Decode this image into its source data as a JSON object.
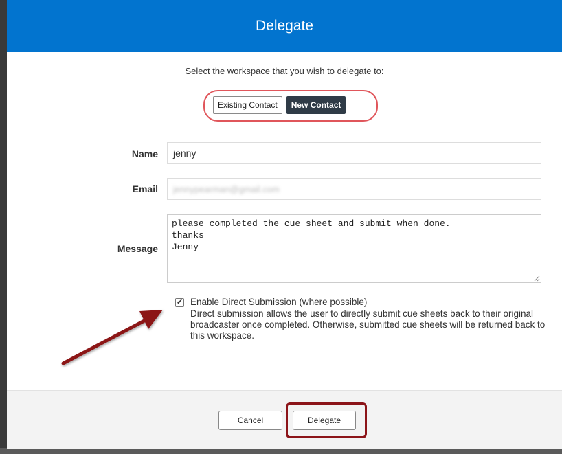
{
  "dialog": {
    "title": "Delegate",
    "prompt": "Select the workspace that you wish to delegate to:",
    "tabs": [
      "Existing Contact",
      "New Contact"
    ],
    "selected_tab": "New Contact"
  },
  "form": {
    "name_label": "Name",
    "name_value": "jenny",
    "email_label": "Email",
    "email_value": "jennypearman@gmail.com",
    "message_label": "Message",
    "message_value": "please completed the cue sheet and submit when done.\nthanks\nJenny"
  },
  "direct_submission": {
    "checked": true,
    "label": "Enable Direct Submission (where possible)",
    "description": "Direct submission allows the user to directly submit cue sheets back to their original broadcaster once completed. Otherwise, submitted cue sheets will be returned back to this workspace."
  },
  "footer": {
    "cancel_label": "Cancel",
    "delegate_label": "Delegate"
  },
  "colors": {
    "header_bg": "#0274cf",
    "annotation_ring": "#e0565b",
    "annotation_dark": "#8c1419"
  }
}
